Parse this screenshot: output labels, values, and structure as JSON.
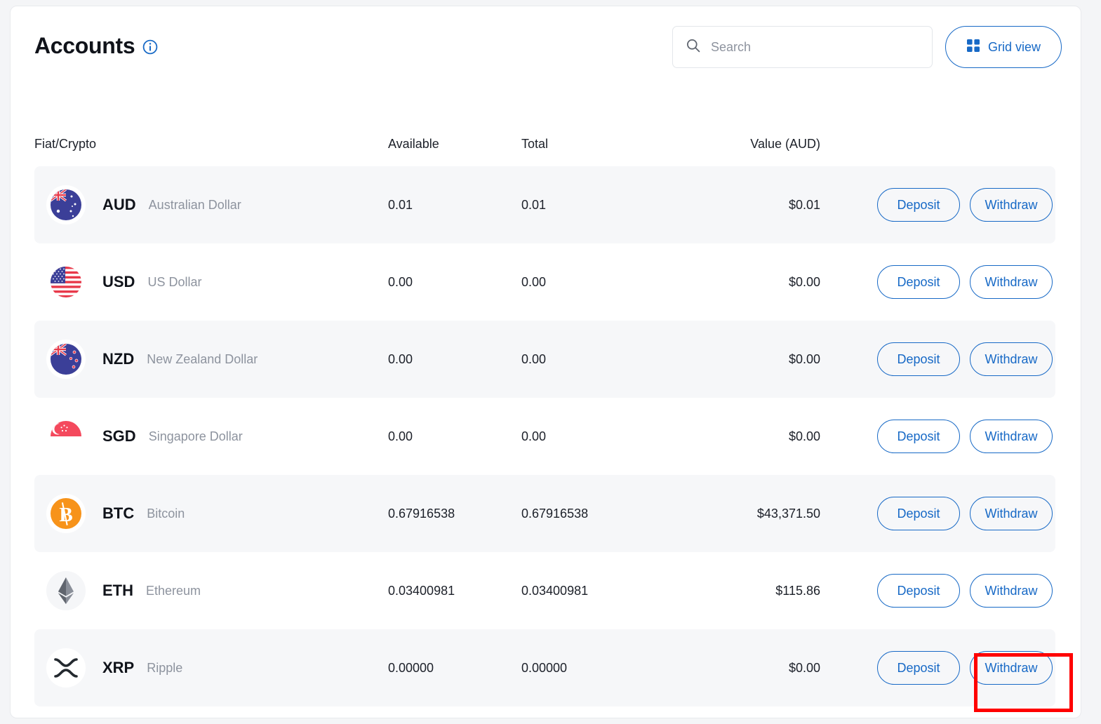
{
  "header": {
    "title": "Accounts",
    "info_icon": "info-icon",
    "search": {
      "placeholder": "Search",
      "value": "",
      "icon": "search-icon"
    },
    "grid_view": {
      "label": "Grid view",
      "icon": "grid-icon"
    }
  },
  "table": {
    "columns": {
      "asset": "Fiat/Crypto",
      "available": "Available",
      "total": "Total",
      "value": "Value (AUD)"
    },
    "actions": {
      "deposit": "Deposit",
      "withdraw": "Withdraw"
    },
    "rows": [
      {
        "code": "AUD",
        "name": "Australian Dollar",
        "icon": "flag-australia-icon",
        "available": "0.01",
        "total": "0.01",
        "value": "$0.01"
      },
      {
        "code": "USD",
        "name": "US Dollar",
        "icon": "flag-united-states-icon",
        "available": "0.00",
        "total": "0.00",
        "value": "$0.00"
      },
      {
        "code": "NZD",
        "name": "New Zealand Dollar",
        "icon": "flag-new-zealand-icon",
        "available": "0.00",
        "total": "0.00",
        "value": "$0.00"
      },
      {
        "code": "SGD",
        "name": "Singapore Dollar",
        "icon": "flag-singapore-icon",
        "available": "0.00",
        "total": "0.00",
        "value": "$0.00"
      },
      {
        "code": "BTC",
        "name": "Bitcoin",
        "icon": "bitcoin-icon",
        "available": "0.67916538",
        "total": "0.67916538",
        "value": "$43,371.50"
      },
      {
        "code": "ETH",
        "name": "Ethereum",
        "icon": "ethereum-icon",
        "available": "0.03400981",
        "total": "0.03400981",
        "value": "$115.86"
      },
      {
        "code": "XRP",
        "name": "Ripple",
        "icon": "ripple-icon",
        "available": "0.00000",
        "total": "0.00000",
        "value": "$0.00"
      }
    ]
  },
  "annotation": {
    "highlight_target": "xrp-withdraw-button",
    "color": "#ff0000"
  },
  "colors": {
    "accent": "#1769c6",
    "row_alt_bg": "#f6f7f9",
    "text": "#1c2029",
    "muted": "#8d939e",
    "bitcoin": "#f7931a"
  }
}
